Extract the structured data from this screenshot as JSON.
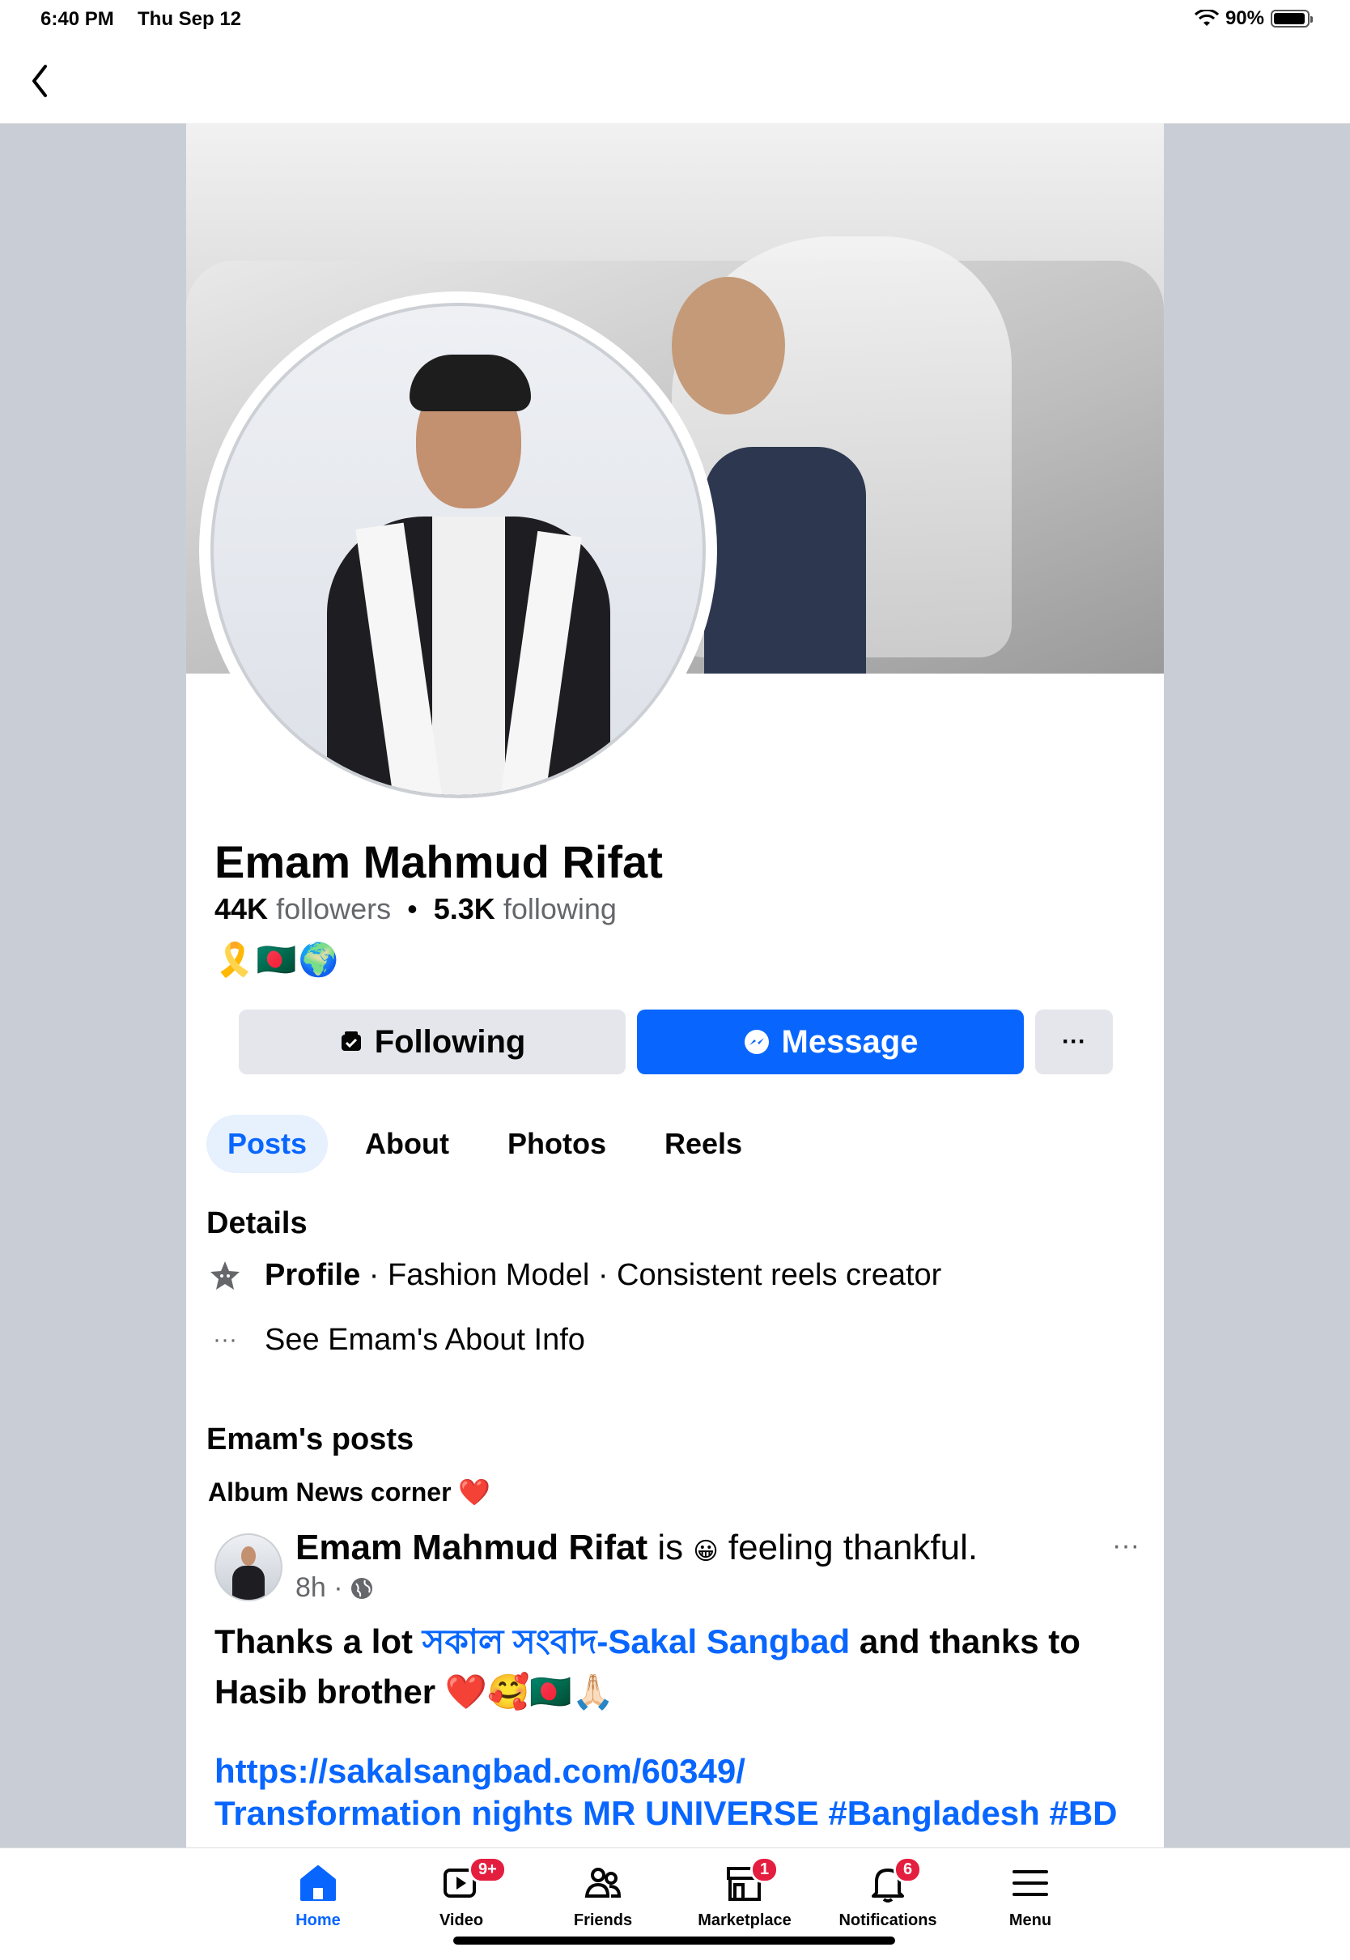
{
  "status_bar": {
    "time": "6:40 PM",
    "date": "Thu Sep 12",
    "battery": "90%"
  },
  "profile": {
    "name": "Emam Mahmud Rifat",
    "followers_count": "44K",
    "followers_label": "followers",
    "following_count": "5.3K",
    "following_label": "following",
    "bio": "🎗️🇧🇩🌍"
  },
  "actions": {
    "following_label": "Following",
    "message_label": "Message",
    "more_label": "···"
  },
  "tabs": [
    {
      "label": "Posts",
      "active": true
    },
    {
      "label": "About",
      "active": false
    },
    {
      "label": "Photos",
      "active": false
    },
    {
      "label": "Reels",
      "active": false
    }
  ],
  "details": {
    "title": "Details",
    "profile_label": "Profile",
    "profile_text": " · Fashion Model · Consistent reels creator",
    "about_link": "See Emam's About Info"
  },
  "posts_section": {
    "title": "Emam's posts",
    "album": "Album News corner ❤️"
  },
  "post": {
    "author": "Emam Mahmud Rifat",
    "activity_prefix": " is ",
    "activity_emoji": "😀",
    "activity_text": " feeling thankful.",
    "time": "8h ·",
    "text_start": "Thanks a lot ",
    "text_link": "সকাল সংবাদ-Sakal Sangbad",
    "text_end": " and thanks to Hasib brother ❤️🥰🇧🇩🙏🏻",
    "url": "https://sakalsangbad.com/60349/",
    "url_title": "Transformation nights MR UNIVERSE #Bangladesh #BD"
  },
  "tab_bar": [
    {
      "label": "Home",
      "badge": ""
    },
    {
      "label": "Video",
      "badge": "9+"
    },
    {
      "label": "Friends",
      "badge": ""
    },
    {
      "label": "Marketplace",
      "badge": "1"
    },
    {
      "label": "Notifications",
      "badge": "6"
    },
    {
      "label": "Menu",
      "badge": ""
    }
  ],
  "colors": {
    "accent": "#0866ff",
    "badge": "#e41e3f",
    "secondary_bg": "#e4e6eb",
    "muted_text": "#65676b"
  }
}
